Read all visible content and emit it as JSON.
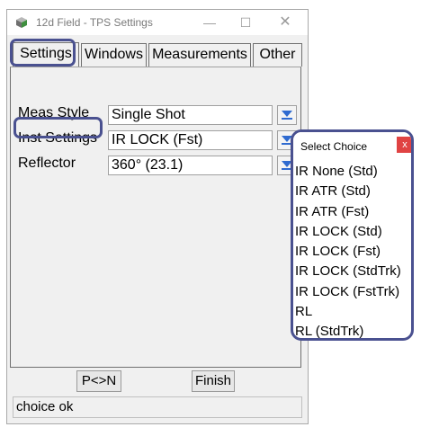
{
  "window": {
    "title": "12d Field - TPS Settings",
    "minimize_glyph": "—",
    "maximize_glyph": "☐",
    "close_glyph": "✕"
  },
  "tabs": [
    {
      "label": "Settings",
      "active": true
    },
    {
      "label": "Windows",
      "active": false
    },
    {
      "label": "Measurements",
      "active": false
    },
    {
      "label": "Other",
      "active": false
    }
  ],
  "fields": {
    "meas_style": {
      "label": "Meas Style",
      "value": "Single Shot"
    },
    "inst_settings": {
      "label": "Inst Settings",
      "value": "IR LOCK (Fst)"
    },
    "reflector": {
      "label": "Reflector",
      "value": "360° (23.1)"
    }
  },
  "buttons": {
    "pn": "P<>N",
    "finish": "Finish"
  },
  "status": "choice ok",
  "popup": {
    "title": "Select Choice",
    "close_glyph": "x",
    "choices": [
      "IR None (Std)",
      "IR ATR  (Std)",
      "IR ATR  (Fst)",
      "IR LOCK (Std)",
      "IR LOCK (Fst)",
      "IR LOCK (StdTrk)",
      "IR LOCK (FstTrk)",
      "RL",
      "RL (StdTrk)"
    ]
  },
  "colors": {
    "highlight": "#4a5190",
    "dropdown_arrow": "#2f6bd0",
    "close_button": "#e04343"
  },
  "icons": {
    "app": "app-cube-icon",
    "dropdown": "chevron-down-icon",
    "close": "close-icon"
  }
}
